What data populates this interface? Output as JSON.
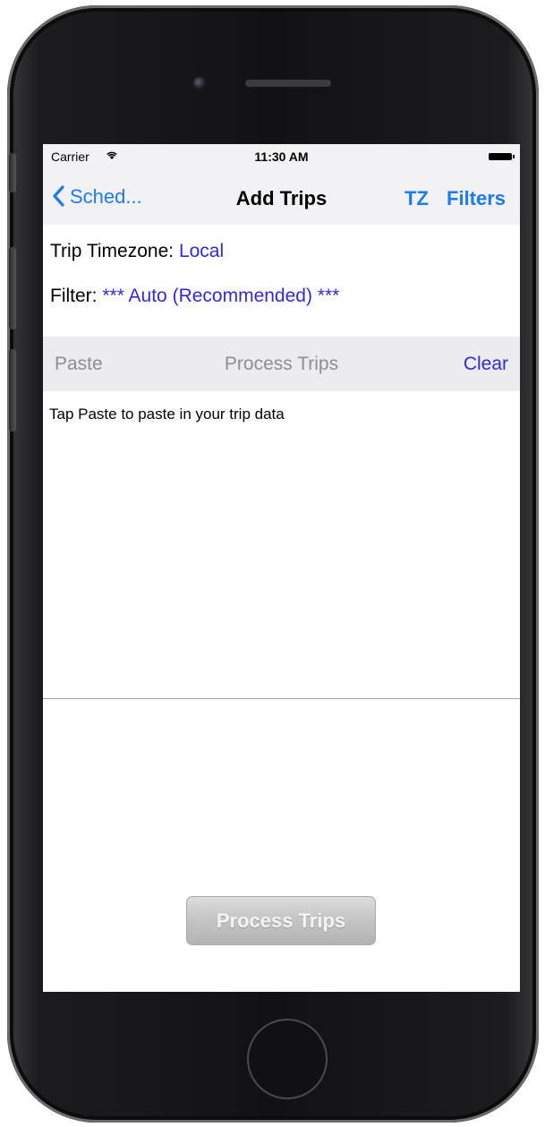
{
  "status_bar": {
    "carrier": "Carrier",
    "wifi_icon": "wifi-icon",
    "time": "11:30 AM",
    "battery_icon": "battery-icon"
  },
  "nav": {
    "back_label": "Sched...",
    "back_icon": "chevron-left-icon",
    "title": "Add Trips",
    "tz_label": "TZ",
    "filters_label": "Filters"
  },
  "settings": {
    "timezone_label": "Trip Timezone:",
    "timezone_value": "Local",
    "filter_label": "Filter:",
    "filter_value": "*** Auto (Recommended) ***"
  },
  "toolbar": {
    "paste_label": "Paste",
    "process_label": "Process Trips",
    "clear_label": "Clear"
  },
  "content": {
    "hint_text": "Tap Paste to paste in your trip data"
  },
  "process_button": {
    "label": "Process Trips"
  },
  "colors": {
    "ios_blue": "#1a7bf5",
    "link_blue": "#2f2bd9",
    "disabled_gray": "#8e8e93",
    "bar_background": "#f2f2f4",
    "toolbar_background": "#ececee"
  }
}
